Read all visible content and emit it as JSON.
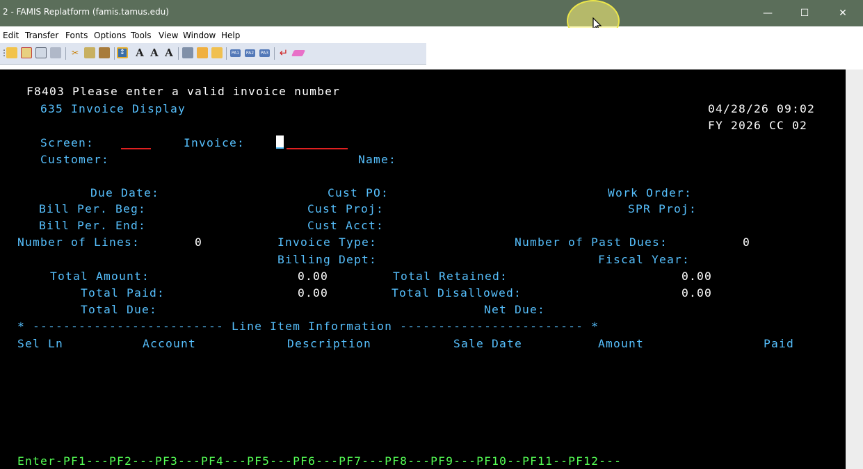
{
  "window": {
    "title": "2 - FAMIS Replatform (famis.tamus.edu)",
    "controls": {
      "minimize": "—",
      "maximize": "☐",
      "close": "✕"
    }
  },
  "menu": [
    "Edit",
    "Transfer",
    "Fonts",
    "Options",
    "Tools",
    "View",
    "Window",
    "Help"
  ],
  "toolbar": {
    "icons": [
      "open-session-icon",
      "new-session-icon",
      "close-session-icon",
      "settings-icon",
      "print-icon",
      "cut-icon",
      "copy-icon",
      "paste-icon",
      "send-receive-icon",
      "font-large-icon",
      "font-medium-icon",
      "font-small-icon",
      "properties-icon",
      "macro-run-icon",
      "macro-record-icon",
      "pa1-key-icon",
      "pa2-key-icon",
      "pa3-key-icon",
      "enter-key-icon",
      "clear-key-icon"
    ],
    "font_letters": [
      "A",
      "A",
      "A"
    ],
    "pa_keys": [
      "PA1",
      "PA2",
      "PA3"
    ]
  },
  "terminal": {
    "message": "F8403 Please enter a valid invoice number",
    "screen_title": "635 Invoice Display",
    "datetime": "04/28/26 09:02",
    "fy_cc": "FY 2026 CC 02",
    "labels": {
      "screen": "Screen:",
      "invoice": "Invoice:",
      "customer": "Customer:",
      "name": "Name:",
      "due_date": "Due Date:",
      "cust_po": "Cust PO:",
      "work_order": "Work Order:",
      "bill_per_beg": "Bill Per. Beg:",
      "cust_proj": "Cust Proj:",
      "spr_proj": "SPR Proj:",
      "bill_per_end": "Bill Per. End:",
      "cust_acct": "Cust Acct:",
      "number_of_lines": "Number of Lines:",
      "invoice_type": "Invoice Type:",
      "number_of_past_dues": "Number of Past Dues:",
      "billing_dept": "Billing Dept:",
      "fiscal_year": "Fiscal Year:",
      "total_amount": "Total Amount:",
      "total_retained": "Total Retained:",
      "total_paid": "Total Paid:",
      "total_disallowed": "Total Disallowed:",
      "total_due": "Total Due:",
      "net_due": "Net Due:"
    },
    "values": {
      "number_of_lines": "0",
      "number_of_past_dues": "0",
      "total_amount": "0.00",
      "total_retained": "0.00",
      "total_paid": "0.00",
      "total_disallowed": "0.00"
    },
    "line_item_banner": "* ------------------------- Line Item Information ------------------------ *",
    "columns": {
      "sel_ln": "Sel Ln",
      "account": "Account",
      "description": "Description",
      "sale_date": "Sale Date",
      "amount": "Amount",
      "paid": "Paid"
    },
    "pf_keys": "Enter-PF1---PF2---PF3---PF4---PF5---PF6---PF7---PF8---PF9---PF10--PF11--PF12---"
  }
}
